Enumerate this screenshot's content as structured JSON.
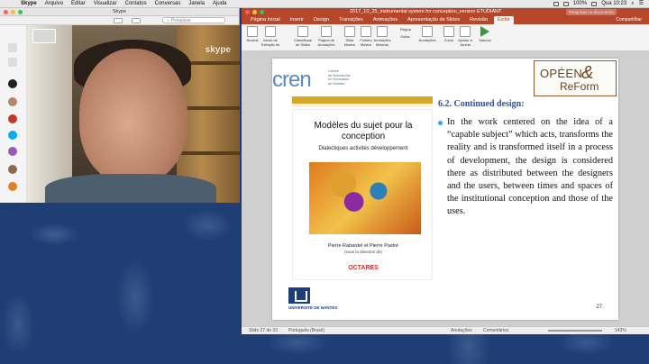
{
  "menubar": {
    "items": [
      "Skype",
      "Arquivo",
      "Editar",
      "Visualizar",
      "Contatos",
      "Conversas",
      "Janela",
      "Ajuda"
    ],
    "status_battery": "100%",
    "status_clock": "Qua 10:23"
  },
  "skype": {
    "window_title": "Skype",
    "search_placeholder": "Pesquisar",
    "watermark": "skype"
  },
  "ppt": {
    "window_title": "2017_10_25_instrumental system for conception_version ETUDIANT",
    "search_placeholder": "Pesquisar no documento",
    "share_label": "Compartilhar",
    "tabs": [
      "Página Inicial",
      "Inserir",
      "Design",
      "Transições",
      "Animações",
      "Apresentação de Slides",
      "Revisão",
      "Exibir"
    ],
    "ribbon": [
      "Normal",
      "Modo de Exibição de Estrutura de Tópicos",
      "Classificador de Slides",
      "Página de Anotações",
      "Slide Mestre",
      "Folheto Mestre",
      "Anotações Mestras",
      "Régua",
      "Guias",
      "Anotações",
      "Zoom",
      "Ajustar à Janela",
      "Macros"
    ],
    "status": {
      "slide": "Slide 27 de 33",
      "language": "Português (Brasil)",
      "notes": "Anotações",
      "comments": "Comentários",
      "zoom": "143%"
    }
  },
  "slide": {
    "cren_logo": "cren",
    "cren_sub": "Centre\nde Recherche\nen Éducation\nde Nantes",
    "opeen_top": "OPÉEN",
    "opeen_amp": "&",
    "opeen_bottom": "ReForm",
    "book_title": "Modèles du sujet pour la conception",
    "book_subtitle": "Dialectiques activités développement",
    "book_authors": "Pierre Rabardel et Pierre Pastré",
    "book_direction": "(sous la direction de)",
    "book_publisher": "OCTARES",
    "university": "UNIVERSITÉ DE NANTES",
    "section_title": "6.2. Continued design:",
    "bullet": "In the work centered on the idea of a “capable subject” which acts, transforms the reality and is transformed itself in a process of development, the design is considered there as distributed between the designers and the users, between times and spaces of the institutional conception and those of the uses.",
    "page_number": "27"
  }
}
